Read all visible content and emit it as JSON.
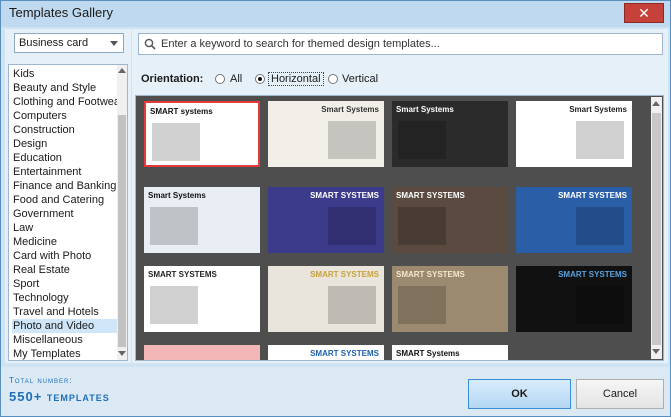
{
  "window": {
    "title": "Templates Gallery",
    "close_icon": "close-icon"
  },
  "category_select": {
    "value": "Business card"
  },
  "categories": [
    "Kids",
    "Beauty and Style",
    "Clothing and Footwear",
    "Computers",
    "Construction",
    "Design",
    "Education",
    "Entertainment",
    "Finance and Banking",
    "Food and Catering",
    "Government",
    "Law",
    "Medicine",
    "Card with Photo",
    "Real Estate",
    "Sport",
    "Technology",
    "Travel and Hotels",
    "Photo and Video",
    "Miscellaneous",
    "My Templates"
  ],
  "selected_category": "Photo and Video",
  "search": {
    "placeholder": "Enter a keyword to search for themed design templates..."
  },
  "orientation": {
    "label": "Orientation:",
    "options": [
      "All",
      "Horizontal",
      "Vertical"
    ],
    "selected": "Horizontal"
  },
  "templates": [
    {
      "title": "SMART systems",
      "bg": "#ffffff",
      "fg": "#111111"
    },
    {
      "title": "Smart Systems",
      "bg": "#f2efe9",
      "fg": "#333333"
    },
    {
      "title": "Smart Systems",
      "bg": "#2b2b2b",
      "fg": "#ffffff"
    },
    {
      "title": "Smart Systems",
      "bg": "#ffffff",
      "fg": "#222222"
    },
    {
      "title": "Smart Systems",
      "bg": "#e8eef3",
      "fg": "#111111"
    },
    {
      "title": "SMART SYSTEMS",
      "bg": "#3c3a8a",
      "fg": "#ffffff"
    },
    {
      "title": "SMART SYSTEMS",
      "bg": "#5a4a40",
      "fg": "#ffffff"
    },
    {
      "title": "SMART SYSTEMS",
      "bg": "#2a5fa8",
      "fg": "#ffffff"
    },
    {
      "title": "SMART SYSTEMS",
      "bg": "#ffffff",
      "fg": "#222222"
    },
    {
      "title": "SMART SYSTEMS",
      "bg": "#e9e4dc",
      "fg": "#c8a23a"
    },
    {
      "title": "SMART SYSTEMS",
      "bg": "#9c8a70",
      "fg": "#f5e7c8"
    },
    {
      "title": "SMART SYSTEMS",
      "bg": "#111111",
      "fg": "#5aa3e0"
    },
    {
      "title": "",
      "bg": "#f3b6b6",
      "fg": "#111111"
    },
    {
      "title": "SMART SYSTEMS",
      "bg": "#ffffff",
      "fg": "#1d5fa8"
    },
    {
      "title": "SMART Systems",
      "bg": "#ffffff",
      "fg": "#111111"
    }
  ],
  "footer": {
    "total_label": "Total number:",
    "total_value": "550+ templates",
    "ok_label": "OK",
    "cancel_label": "Cancel"
  },
  "colors": {
    "accent": "#1d6fb8",
    "selection": "#e33b3b"
  }
}
